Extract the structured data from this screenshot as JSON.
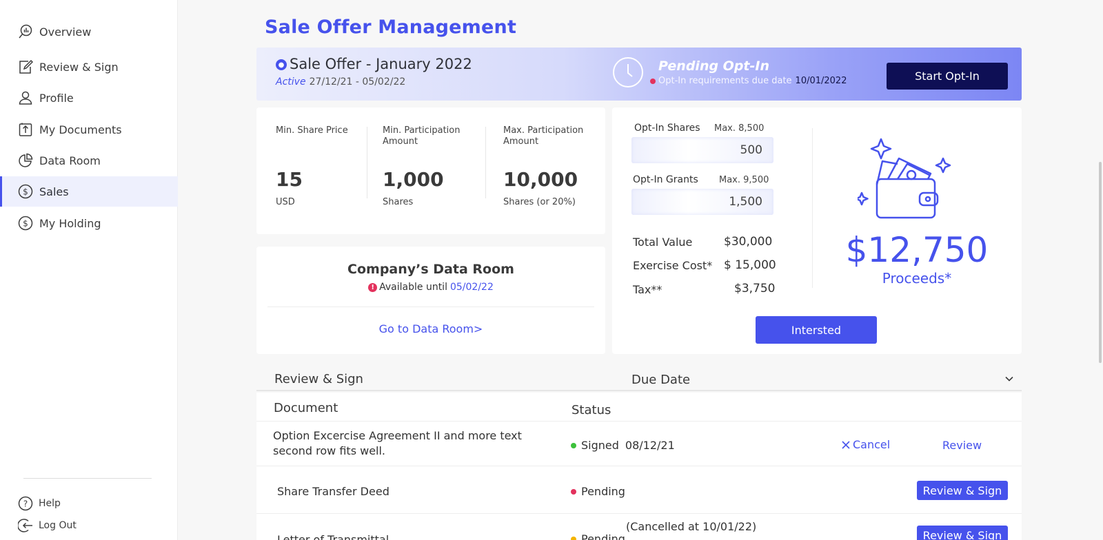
{
  "sidebar": {
    "items": [
      {
        "label": "Overview",
        "icon": "overview-search-chart-icon"
      },
      {
        "label": "Review & Sign",
        "icon": "edit-document-icon"
      },
      {
        "label": "Profile",
        "icon": "user-icon"
      },
      {
        "label": "My Documents",
        "icon": "document-upload-icon"
      },
      {
        "label": "Data Room",
        "icon": "pie-chart-icon"
      },
      {
        "label": "Sales",
        "icon": "dollar-circle-icon",
        "active": true
      },
      {
        "label": "My Holding",
        "icon": "dollar-circle-icon"
      }
    ],
    "footer": [
      {
        "label": "Help",
        "icon": "help-circle-icon"
      },
      {
        "label": "Log Out",
        "icon": "logout-icon"
      }
    ]
  },
  "page": {
    "title": "Sale Offer Management"
  },
  "banner": {
    "title": "Sale Offer - January 2022",
    "status": "Active",
    "period": "27/12/21 - 05/02/22",
    "pending_title": "Pending Opt-In",
    "requirements_text": "Opt-In requirements due date",
    "requirements_date": "10/01/2022",
    "start_button": "Start Opt-In"
  },
  "metrics": [
    {
      "label": "Min. Share Price",
      "value": "15",
      "unit": "USD"
    },
    {
      "label": "Min. Participation Amount",
      "value": "1,000",
      "unit": "Shares"
    },
    {
      "label": "Max. Participation Amount",
      "value": "10,000",
      "unit": "Shares (or 20%)"
    }
  ],
  "data_room": {
    "title": "Company’s Data Room",
    "available_text": "Available until",
    "available_date": "05/02/22",
    "link": "Go to Data Room>"
  },
  "opt_in": {
    "shares_label": "Opt-In Shares",
    "shares_max": "Max. 8,500",
    "shares_value": "500",
    "grants_label": "Opt-In Grants",
    "grants_max": "Max. 9,500",
    "grants_value": "1,500",
    "total_value_label": "Total Value",
    "total_value": "$30,000",
    "exercise_cost_label": "Exercise Cost*",
    "exercise_cost": "$ 15,000",
    "tax_label": "Tax**",
    "tax": "$3,750",
    "proceeds_value": "$12,750",
    "proceeds_label": "Proceeds*",
    "interested_button": "Intersted"
  },
  "review": {
    "section_title": "Review & Sign",
    "due_date_header": "Due Date",
    "columns": {
      "document": "Document",
      "status": "Status"
    },
    "rows": [
      {
        "document": "Option Excercise Agreement II and more text second row fits well.",
        "status": "Signed",
        "date": "08/12/21",
        "cancel": "Cancel",
        "action": "Review"
      },
      {
        "document": "Share Transfer Deed",
        "status": "Pending",
        "action": "Review & Sign"
      },
      {
        "document": "Letter of Transmittal",
        "status": "Pending",
        "note": "(Cancelled at 10/01/22)",
        "action": "Review & Sign"
      }
    ]
  },
  "colors": {
    "accent": "#4652ec",
    "dark_button": "#0e0f55",
    "signed": "#3cc13b",
    "pending_red": "#e3325d",
    "pending_yellow": "#f4b400"
  }
}
